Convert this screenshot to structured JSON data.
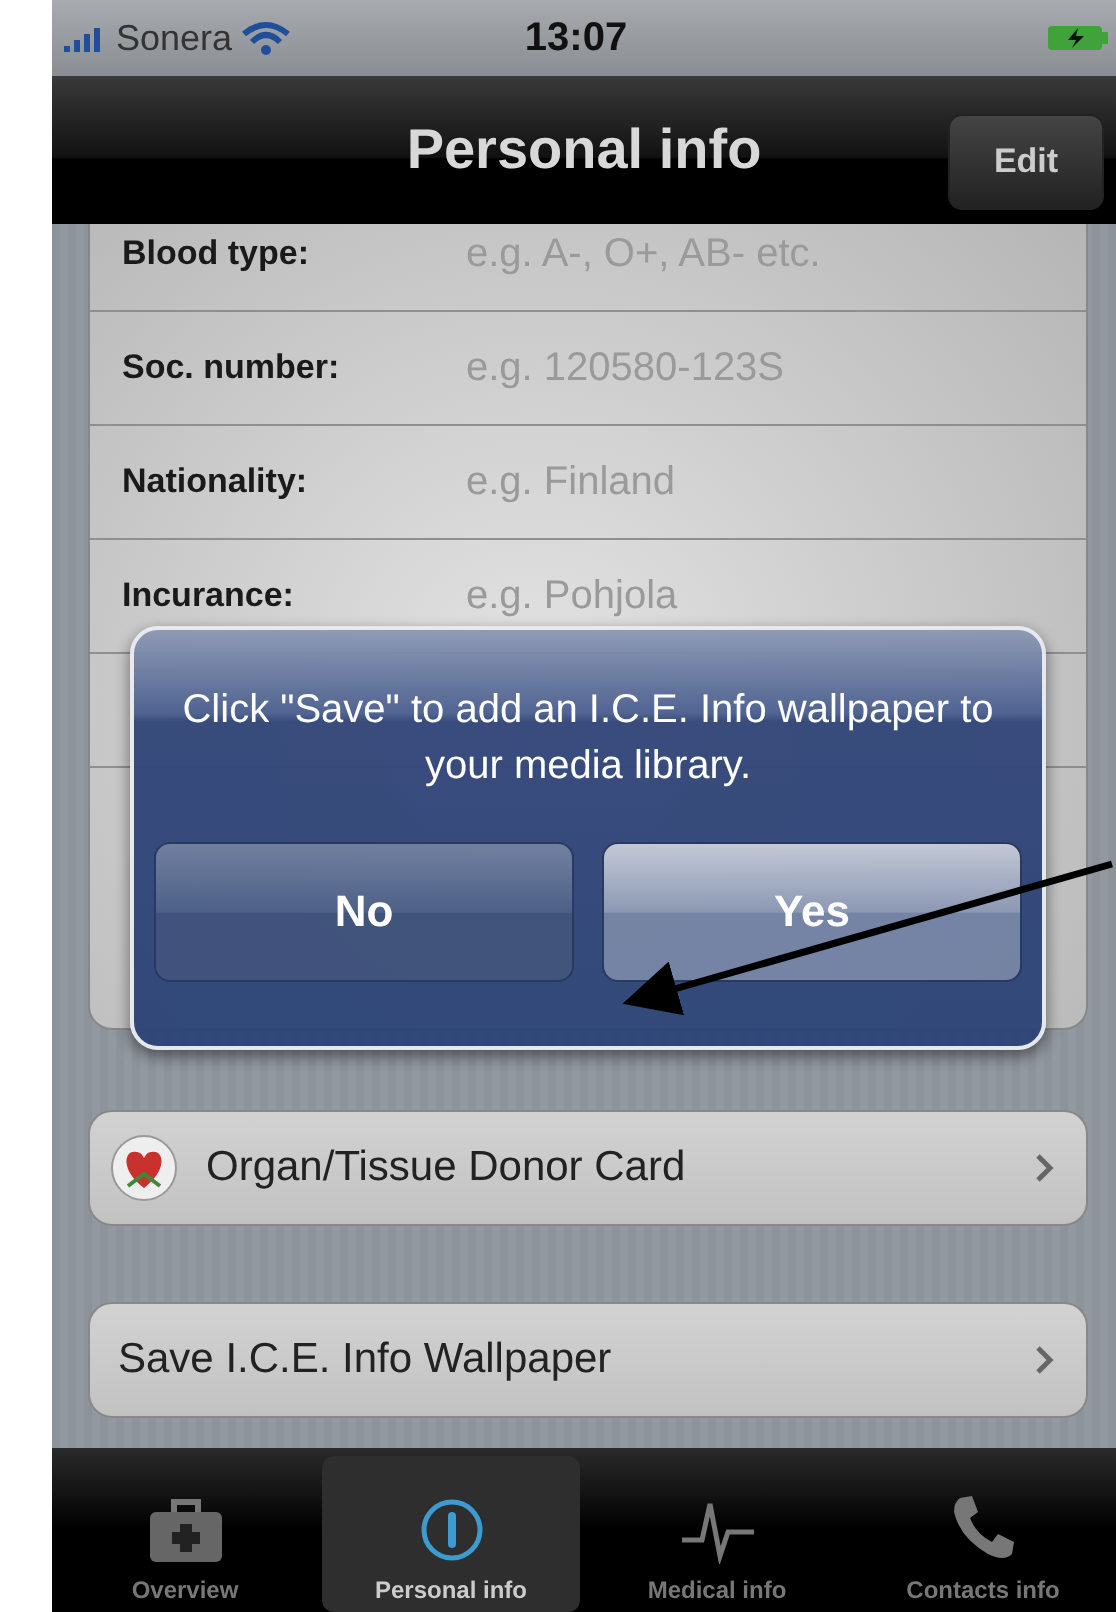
{
  "status_bar": {
    "carrier": "Sonera",
    "time": "13:07"
  },
  "nav_bar": {
    "title": "Personal info",
    "edit_button": "Edit"
  },
  "form_rows": [
    {
      "label": "Blood type:",
      "placeholder": "e.g. A-, O+, AB- etc."
    },
    {
      "label": "Soc. number:",
      "placeholder": "e.g. 120580-123S"
    },
    {
      "label": "Nationality:",
      "placeholder": "e.g. Finland"
    },
    {
      "label": "Incurance:",
      "placeholder": "e.g. Pohjola"
    }
  ],
  "cells": [
    {
      "kind": "donor",
      "label": "Organ/Tissue Donor Card"
    },
    {
      "kind": "plain",
      "label": "Save I.C.E. Info Wallpaper"
    }
  ],
  "alert": {
    "message": "Click \"Save\" to add an I.C.E. Info wallpaper to your media library.",
    "buttons": [
      "No",
      "Yes"
    ]
  },
  "tab_bar": [
    {
      "kind": "kit",
      "label": "Overview",
      "selected": false
    },
    {
      "kind": "info",
      "label": "Personal info",
      "selected": true
    },
    {
      "kind": "pulse",
      "label": "Medical info",
      "selected": false
    },
    {
      "kind": "phone",
      "label": "Contacts info",
      "selected": false
    }
  ]
}
